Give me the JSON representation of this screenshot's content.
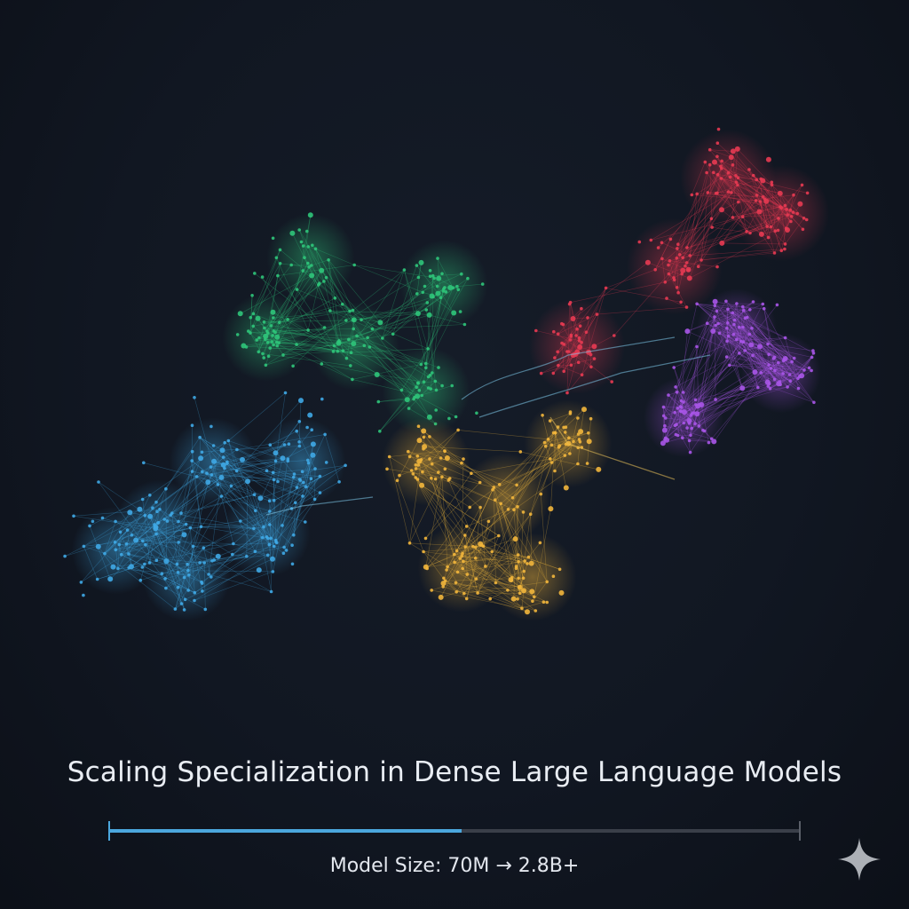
{
  "title": "Scaling Specialization in Dense Large Language Models",
  "scale_bar": {
    "caption": "Model Size: 70M → 2.8B+",
    "progress": 0.51,
    "fill_color": "#4ba7dd",
    "track_color": "#3a3f49"
  },
  "clusters": [
    {
      "color": "#3fa9e6"
    },
    {
      "color": "#2fc57a"
    },
    {
      "color": "#f2b63c"
    },
    {
      "color": "#e83a52"
    },
    {
      "color": "#a955e8"
    }
  ],
  "background": "#111722",
  "icons": {
    "corner": "sparkle-icon"
  }
}
